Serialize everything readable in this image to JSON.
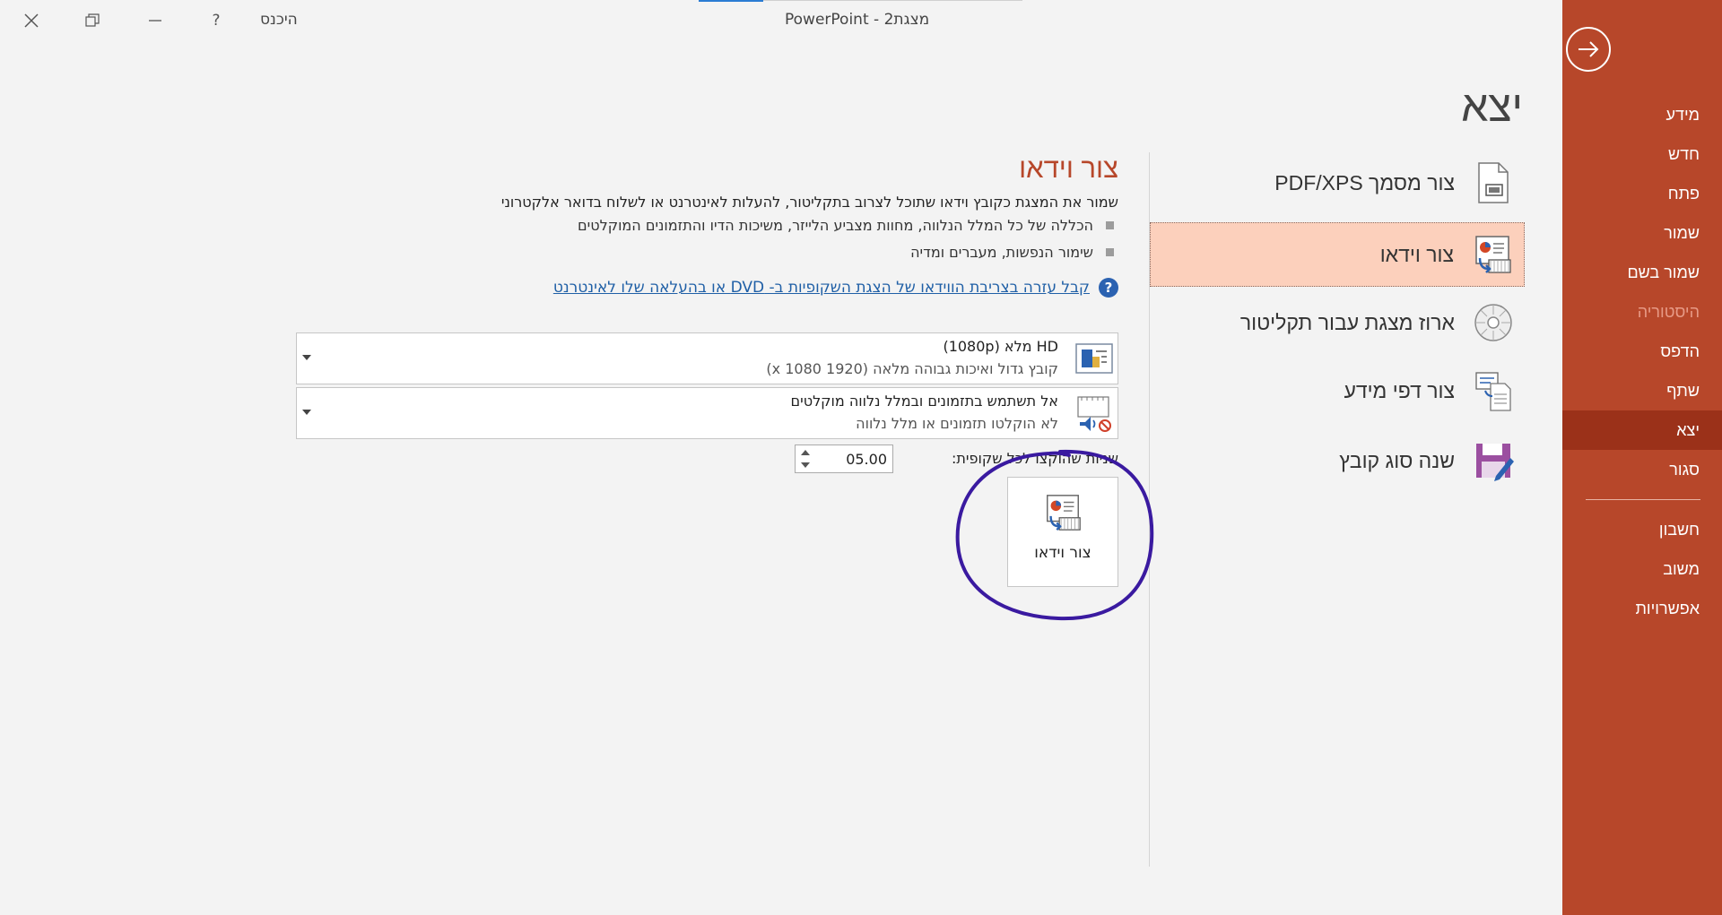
{
  "window": {
    "title": "מצגת2  -  PowerPoint",
    "sign_in": "היכנס",
    "help": "?",
    "minimize": "—",
    "restore": "❐",
    "close": "✕"
  },
  "backstage_nav": {
    "items": [
      {
        "label": "מידע"
      },
      {
        "label": "חדש"
      },
      {
        "label": "פתח"
      },
      {
        "label": "שמור"
      },
      {
        "label": "שמור בשם"
      },
      {
        "label": "היסטוריה"
      },
      {
        "label": "הדפס"
      },
      {
        "label": "שתף"
      },
      {
        "label": "יצא"
      },
      {
        "label": "סגור"
      },
      {
        "label": "חשבון"
      },
      {
        "label": "משוב"
      },
      {
        "label": "אפשרויות"
      }
    ],
    "selected": "יצא",
    "disabled": "היסטוריה"
  },
  "page": {
    "title": "יצא"
  },
  "export_options": [
    {
      "label": "צור מסמך PDF/XPS",
      "icon": "pdf-document-icon"
    },
    {
      "label": "צור וידאו",
      "icon": "create-video-icon",
      "selected": true
    },
    {
      "label": "ארוז מצגת עבור תקליטור",
      "icon": "cd-icon"
    },
    {
      "label": "צור דפי מידע",
      "icon": "handouts-icon"
    },
    {
      "label": "שנה סוג קובץ",
      "icon": "save-floppy-icon"
    }
  ],
  "detail": {
    "heading": "צור וידאו",
    "description": "שמור את המצגת כקובץ וידאו שתוכל לצרוב בתקליטור, להעלות לאינטרנט או לשלוח בדואר אלקטרוני",
    "bullets": [
      "הכללה של כל המלל הנלווה, מחוות מצביע הלייזר, משיכות הדיו והתזמונים המוקלטים",
      "שימור הנפשות, מעברים ומדיה"
    ],
    "help_link": "קבל עזרה בצריבת הווידאו של הצגת השקופיות ב- DVD או בהעלאה שלו לאינטרנט",
    "quality_dropdown": {
      "title": "HD מלא (1080p)",
      "subtitle": "קובץ גדול ואיכות גבוהה מלאה (1920 x 1080)"
    },
    "timing_dropdown": {
      "title": "אל תשתמש בתזמונים ובמלל נלווה מוקלטים",
      "subtitle": "לא הוקלטו תזמונים או מלל נלווה"
    },
    "seconds_label": "שניות שהוקצו לכל שקופית:",
    "seconds_value": "05.00",
    "create_button_label": "צור וידאו"
  },
  "colors": {
    "nav_background": "#b7472a",
    "nav_selected": "#9b3119",
    "selected_option": "#fcd0bc",
    "heading_accent": "#b7472a",
    "link": "#1f5fa6",
    "annotation": "#3a1aa0"
  }
}
